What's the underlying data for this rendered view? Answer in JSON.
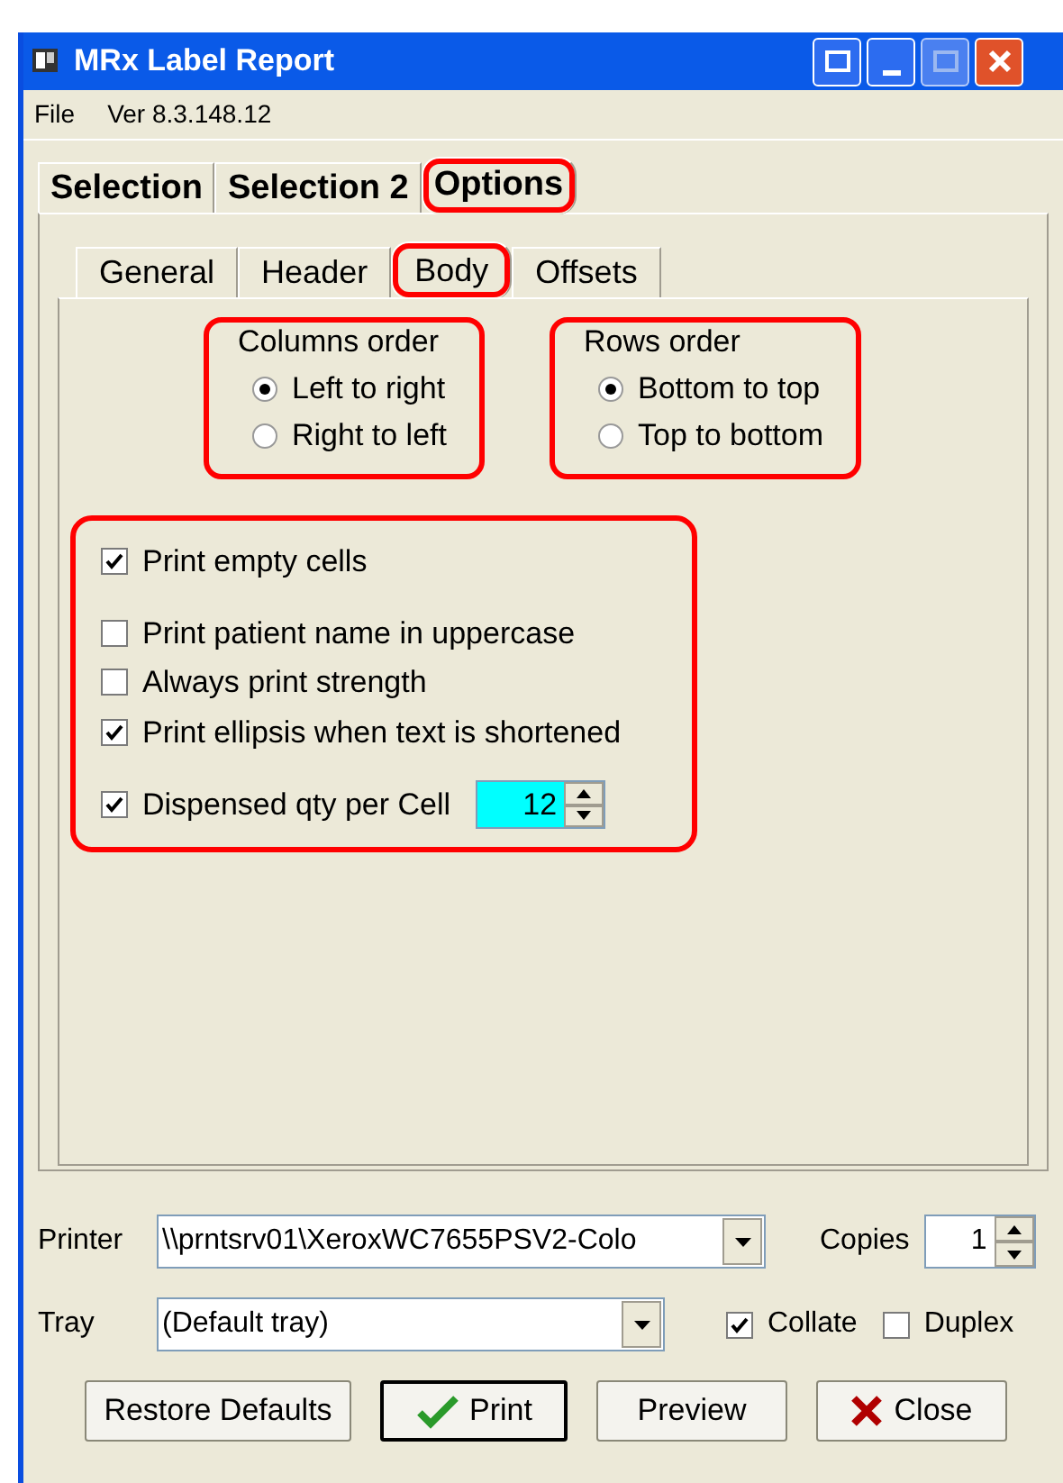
{
  "window": {
    "title": "MRx Label Report"
  },
  "menu": [
    "File",
    "Ver 8.3.148.12"
  ],
  "tabs": [
    {
      "label": "Selection",
      "selected": false,
      "highlighted": false
    },
    {
      "label": "Selection 2",
      "selected": false,
      "highlighted": false
    },
    {
      "label": "Options",
      "selected": true,
      "highlighted": true
    }
  ],
  "subtabs": [
    {
      "label": "General",
      "selected": false,
      "highlighted": false
    },
    {
      "label": "Header",
      "selected": false,
      "highlighted": false
    },
    {
      "label": "Body",
      "selected": true,
      "highlighted": true
    },
    {
      "label": "Offsets",
      "selected": false,
      "highlighted": false
    }
  ],
  "groups": [
    {
      "title": "Columns order",
      "highlighted": true,
      "options": [
        {
          "label": "Left to right",
          "selected": true
        },
        {
          "label": "Right to left",
          "selected": false
        }
      ]
    },
    {
      "title": "Rows order",
      "highlighted": true,
      "options": [
        {
          "label": "Bottom to top",
          "selected": true
        },
        {
          "label": "Top to bottom",
          "selected": false
        }
      ]
    }
  ],
  "checks": {
    "highlighted": true,
    "sections": [
      [
        {
          "kind": "check",
          "label": "Print empty cells",
          "checked": true
        }
      ],
      [
        {
          "kind": "check",
          "label": "Print patient name in uppercase",
          "checked": false
        },
        {
          "kind": "check",
          "label": "Always print strength",
          "checked": false
        },
        {
          "kind": "check",
          "label": "Print ellipsis when text is shortened",
          "checked": true
        }
      ],
      [
        {
          "kind": "spin",
          "label": "Dispensed qty per Cell",
          "checked": true,
          "value": "12"
        }
      ]
    ]
  },
  "printer": {
    "label": "Printer",
    "value": "\\\\prntsrv01\\XeroxWC7655PSV2-Colo",
    "copies_label": "Copies",
    "copies": "1"
  },
  "tray": {
    "label": "Tray",
    "value": "(Default tray)",
    "collate": {
      "label": "Collate",
      "checked": true
    },
    "duplex": {
      "label": "Duplex",
      "checked": false
    }
  },
  "buttons": [
    {
      "kind": "plain",
      "label": "Restore Defaults",
      "default": false
    },
    {
      "kind": "check",
      "label": "Print",
      "default": true
    },
    {
      "kind": "plain",
      "label": "Preview",
      "default": false
    },
    {
      "kind": "close",
      "label": "Close",
      "default": false
    }
  ]
}
